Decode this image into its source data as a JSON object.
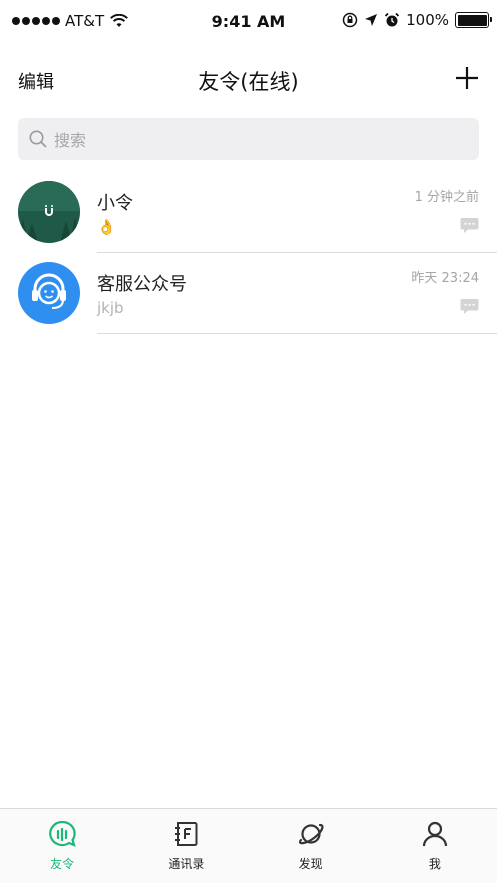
{
  "status_bar": {
    "carrier": "AT&T",
    "time": "9:41 AM",
    "battery": "100%"
  },
  "nav": {
    "left_label": "编辑",
    "title": "友令(在线)",
    "add_icon": "plus-icon"
  },
  "search": {
    "placeholder": "搜索"
  },
  "chats": [
    {
      "name": "小令",
      "preview": "👌",
      "time": "1 分钟之前",
      "avatar": "forest-avatar"
    },
    {
      "name": "客服公众号",
      "preview": "jkjb",
      "time": "昨天 23:24",
      "avatar": "support-headset-avatar"
    }
  ],
  "tabs": [
    {
      "label": "友令",
      "icon": "chat-bubble-icon",
      "active": true
    },
    {
      "label": "通讯录",
      "icon": "contacts-book-icon",
      "active": false
    },
    {
      "label": "发现",
      "icon": "planet-icon",
      "active": false
    },
    {
      "label": "我",
      "icon": "person-icon",
      "active": false
    }
  ],
  "colors": {
    "accent": "#1db877",
    "support_avatar": "#2f8ff0",
    "forest_avatar": "#1f5a48"
  }
}
